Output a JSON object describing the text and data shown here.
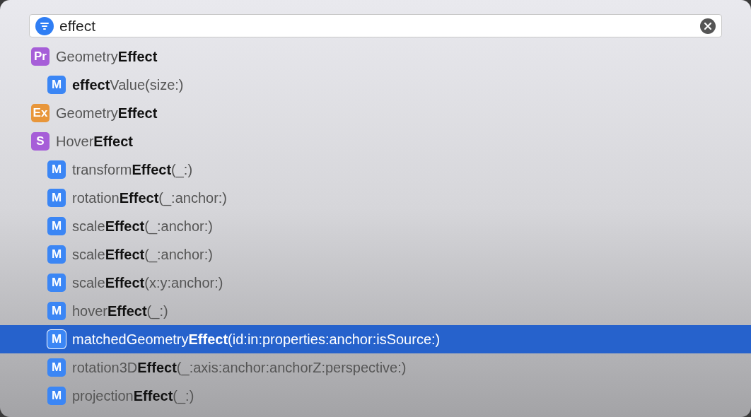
{
  "search": {
    "value": "effect"
  },
  "results": [
    {
      "badge": "Pr",
      "color": "#a65ed8",
      "label": "Geometry**Effect**",
      "selected": false,
      "children": [
        {
          "badge": "M",
          "color": "#3b86f5",
          "label": "**effect**Value(size:)",
          "selected": false
        }
      ]
    },
    {
      "badge": "Ex",
      "color": "#e8963a",
      "label": "Geometry**Effect**",
      "selected": false
    },
    {
      "badge": "S",
      "color": "#a65ed8",
      "label": "Hover**Effect**",
      "selected": false,
      "children": [
        {
          "badge": "M",
          "color": "#3b86f5",
          "label": "transform**Effect**(_:)",
          "selected": false
        },
        {
          "badge": "M",
          "color": "#3b86f5",
          "label": "rotation**Effect**(_:anchor:)",
          "selected": false
        },
        {
          "badge": "M",
          "color": "#3b86f5",
          "label": "scale**Effect**(_:anchor:)",
          "selected": false
        },
        {
          "badge": "M",
          "color": "#3b86f5",
          "label": "scale**Effect**(_:anchor:)",
          "selected": false
        },
        {
          "badge": "M",
          "color": "#3b86f5",
          "label": "scale**Effect**(x:y:anchor:)",
          "selected": false
        },
        {
          "badge": "M",
          "color": "#3b86f5",
          "label": "hover**Effect**(_:)",
          "selected": false
        },
        {
          "badge": "M",
          "color": "#3b86f5",
          "label": "matchedGeometry**Effect**(id:in:properties:anchor:isSource:)",
          "selected": true
        },
        {
          "badge": "M",
          "color": "#3b86f5",
          "label": "rotation3D**Effect**(_:axis:anchor:anchorZ:perspective:)",
          "selected": false
        },
        {
          "badge": "M",
          "color": "#3b86f5",
          "label": "projection**Effect**(_:)",
          "selected": false
        }
      ]
    }
  ]
}
